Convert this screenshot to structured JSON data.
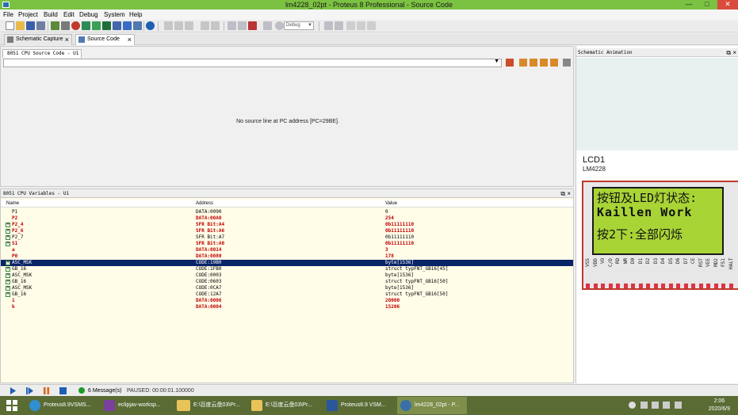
{
  "window": {
    "title": "lm4228_02pt - Proteus 8 Professional - Source Code"
  },
  "menu": [
    "File",
    "Project",
    "Build",
    "Edit",
    "Debug",
    "System",
    "Help"
  ],
  "toolbar": {
    "debug_select": "Debug"
  },
  "tabs": [
    {
      "label": "Schematic Capture"
    },
    {
      "label": "Source Code"
    }
  ],
  "source_panel": {
    "tab": "8051 CPU Source Code - U1",
    "message": "No source line at PC address [PC=29BE]."
  },
  "variables_panel": {
    "title": "8051 CPU Variables - U1",
    "columns": {
      "name": "Name",
      "address": "Address",
      "value": "Value"
    },
    "rows": [
      {
        "name": "P1",
        "address": "DATA:0090",
        "value": "0",
        "changed": false,
        "expand": false
      },
      {
        "name": "P2",
        "address": "DATA:00A0",
        "value": "254",
        "changed": true,
        "expand": false
      },
      {
        "name": "P2_4",
        "address": "SFR Bit:A4",
        "value": "0b11111110",
        "changed": true,
        "expand": true
      },
      {
        "name": "P2_6",
        "address": "SFR Bit:A6",
        "value": "0b11111110",
        "changed": true,
        "expand": true
      },
      {
        "name": "P2_7",
        "address": "SFR Bit:A7",
        "value": "0b11111110",
        "changed": false,
        "expand": true
      },
      {
        "name": "S1",
        "address": "SFR Bit:A0",
        "value": "0b11111110",
        "changed": true,
        "expand": true
      },
      {
        "name": "a",
        "address": "DATA:0014",
        "value": "3",
        "changed": true,
        "expand": false
      },
      {
        "name": "P0",
        "address": "DATA:0080",
        "value": "178",
        "changed": true,
        "expand": false
      },
      {
        "name": "ASC_MSK",
        "address": "CODE:19B0",
        "value": "byte[1536]",
        "changed": false,
        "expand": true,
        "selected": true
      },
      {
        "name": "GB_16",
        "address": "CODE:1FB0",
        "value": "struct typFNT_GB16[45]",
        "changed": false,
        "expand": true
      },
      {
        "name": "ASC_MSK",
        "address": "CODE:0003",
        "value": "byte[1536]",
        "changed": false,
        "expand": true
      },
      {
        "name": "GB_16",
        "address": "CODE:0603",
        "value": "struct typFNT_GB16[50]",
        "changed": false,
        "expand": true
      },
      {
        "name": "ASC_MSK",
        "address": "CODE:0CA7",
        "value": "byte[1536]",
        "changed": false,
        "expand": true
      },
      {
        "name": "GB_16",
        "address": "CODE:12A7",
        "value": "struct typFNT_GB16[50]",
        "changed": false,
        "expand": true
      },
      {
        "name": "i",
        "address": "DATA:0006",
        "value": "20000",
        "changed": true,
        "expand": false
      },
      {
        "name": "k",
        "address": "DATA:0004",
        "value": "15206",
        "changed": true,
        "expand": false
      }
    ]
  },
  "animation_panel": {
    "title": "Schematic Animation",
    "lcd_name": "LCD1",
    "lcd_part": "LM4228",
    "lcd_lines": [
      "按钮及LED灯状态:",
      "Kaillen Work",
      "按2下:全部闪烁"
    ],
    "pins": [
      "VSS",
      "VDD",
      "VO",
      "C/D",
      "RD",
      "WR",
      "D0",
      "D1",
      "D2",
      "D3",
      "D4",
      "D5",
      "D6",
      "D7",
      "CE",
      "RST",
      "VEE",
      "MD2",
      "FS1",
      "HALT"
    ]
  },
  "simbar": {
    "messages": "6 Message(s)",
    "status": "PAUSED: 00:00:01.100000"
  },
  "taskbar": {
    "tasks": [
      {
        "label": "Proteus8.9VSMS..."
      },
      {
        "label": "eclipjav-worksp..."
      },
      {
        "label": ""
      },
      {
        "label": "E:\\百度云盘03\\Pr..."
      },
      {
        "label": ""
      },
      {
        "label": "E:\\百度云盘03\\Pr..."
      },
      {
        "label": "Proteus8.9 VSM..."
      },
      {
        "label": "lm4228_02pt - P..."
      }
    ],
    "time": "2:06",
    "date": "2020/6/9"
  },
  "colors": {
    "titlebar": "#7bc142",
    "changed_value": "#c00000",
    "selected_row": "#0a2468",
    "lcd_screen": "#a8d436",
    "taskbar": "#5a6b34"
  }
}
